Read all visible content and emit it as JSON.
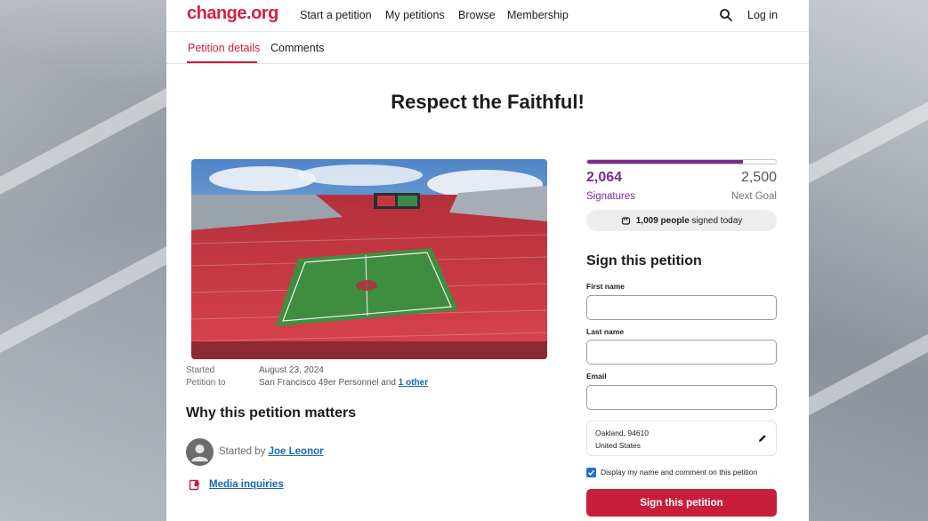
{
  "nav": {
    "logo": "change.org",
    "links": [
      "Start a petition",
      "My petitions",
      "Browse",
      "Membership"
    ],
    "login": "Log in",
    "search_icon": "search-icon"
  },
  "tabs": [
    "Petition details",
    "Comments"
  ],
  "petition": {
    "title": "Respect the Faithful!",
    "started_label": "Started",
    "started_date": "August 23, 2024",
    "petition_to_label": "Petition to",
    "petition_to": "San Francisco 49er Personnel and",
    "petition_to_other": "1 other",
    "why_heading": "Why this petition matters",
    "started_by_prefix": "Started by",
    "author": "Joe Leonor",
    "media_link": "Media inquiries"
  },
  "stats": {
    "signatures": "2,064",
    "signatures_label": "Signatures",
    "goal": "2,500",
    "goal_label": "Next Goal",
    "progress_fraction": 0.8256,
    "today_count": "1,009 people",
    "today_suffix": "signed today"
  },
  "form": {
    "title": "Sign this petition",
    "first_name_label": "First name",
    "first_name_value": "",
    "last_name_label": "Last name",
    "last_name_value": "",
    "email_label": "Email",
    "email_value": "",
    "location_line1": "Oakland, 94610",
    "location_line2": "United States",
    "display_checkbox_label": "Display my name and comment on this petition",
    "display_checked": true,
    "submit_label": "Sign this petition"
  },
  "colors": {
    "brand_red": "#c81e3a",
    "progress_purple": "#7b2a8d",
    "link_blue": "#1566b4",
    "checkbox_blue": "#1f6fd1"
  }
}
